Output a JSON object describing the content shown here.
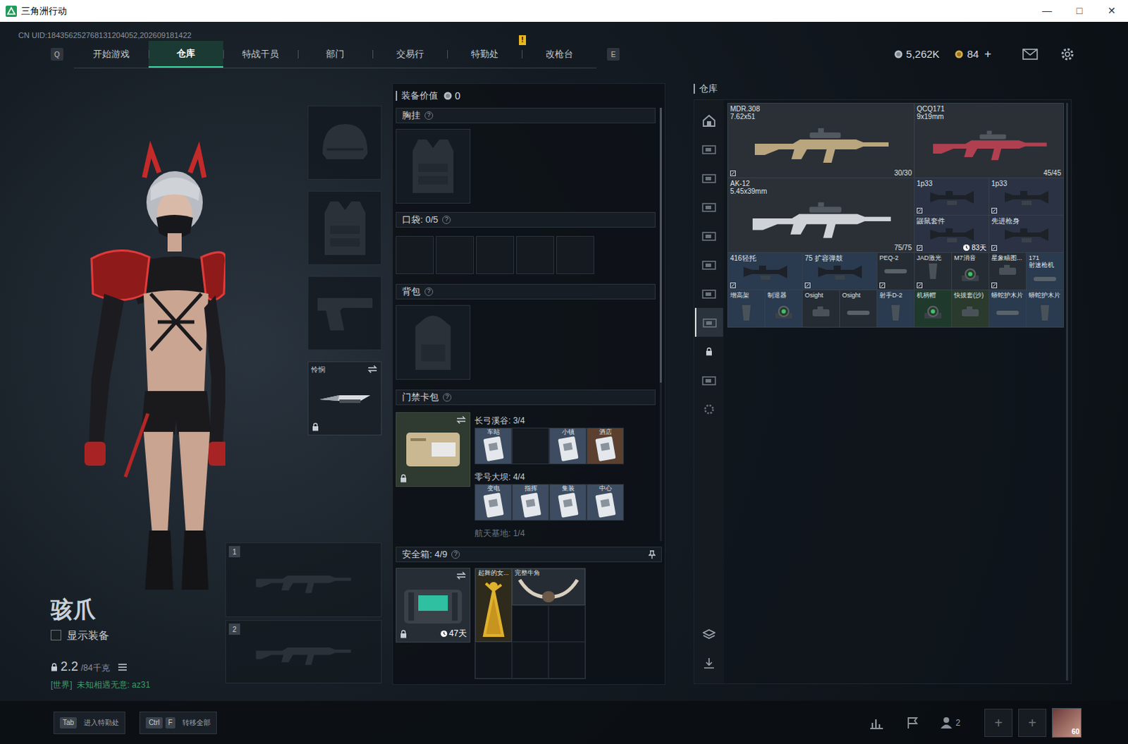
{
  "window": {
    "title": "三角洲行动",
    "controls": [
      "—",
      "□",
      "✕"
    ]
  },
  "uid": "CN UID:184356252768131204052,202609181422",
  "nav": {
    "left_key": "Q",
    "right_key": "E",
    "tabs": [
      {
        "label": "开始游戏",
        "selected": false,
        "badge": ""
      },
      {
        "label": "仓库",
        "selected": true,
        "badge": ""
      },
      {
        "label": "特战干员",
        "selected": false,
        "badge": ""
      },
      {
        "label": "部门",
        "selected": false,
        "badge": ""
      },
      {
        "label": "交易行",
        "selected": false,
        "badge": ""
      },
      {
        "label": "特勤处",
        "selected": false,
        "badge": "!"
      },
      {
        "label": "改枪台",
        "selected": false,
        "badge": ""
      }
    ]
  },
  "currency": {
    "silver": "5,262K",
    "gold": "84",
    "add": "+"
  },
  "operator": {
    "name": "骇爪",
    "show_equipment": {
      "label": "显示装备",
      "checked": false
    },
    "weight": "2.2",
    "weight_max": "/84千克",
    "chat": {
      "channel": "[世界]",
      "text": "未知相遇无意: az31"
    }
  },
  "equipment": {
    "slots": [
      {
        "kind": "helmet",
        "filled": false,
        "label": "",
        "locked": false
      },
      {
        "kind": "armor",
        "filled": false,
        "label": "",
        "locked": false
      },
      {
        "kind": "pistol",
        "filled": false,
        "label": "",
        "locked": false
      },
      {
        "kind": "melee",
        "filled": true,
        "label": "怜悯",
        "locked": true
      }
    ],
    "weapon_slots": [
      "1",
      "2"
    ]
  },
  "loadout": {
    "value_label": "装备价值",
    "value": "0",
    "chest": {
      "title": "胸挂",
      "help": "?",
      "filled": false
    },
    "pocket": {
      "title": "口袋: 0/5",
      "help": "?",
      "slots": [
        {
          "filled": false
        },
        {
          "filled": false
        },
        {
          "filled": false
        },
        {
          "filled": false
        },
        {
          "filled": false
        }
      ]
    },
    "backpack": {
      "title": "背包",
      "help": "?",
      "filled": false
    },
    "card_pack": {
      "title": "门禁卡包",
      "help": "?",
      "locked": true,
      "groups": [
        {
          "name": "长弓溪谷: 3/4",
          "dim": false,
          "cards": [
            {
              "label": "车站",
              "filled": true,
              "color": "#3d4c60"
            },
            {
              "label": "",
              "filled": false,
              "color": "#141a20"
            },
            {
              "label": "小镇",
              "filled": true,
              "color": "#3d4c60"
            },
            {
              "label": "酒店",
              "filled": true,
              "color": "#5b4030"
            }
          ]
        },
        {
          "name": "零号大坝: 4/4",
          "dim": false,
          "cards": [
            {
              "label": "变电",
              "filled": true,
              "color": "#3d4c60"
            },
            {
              "label": "指挥",
              "filled": true,
              "color": "#3d4c60"
            },
            {
              "label": "集装",
              "filled": true,
              "color": "#3d4c60"
            },
            {
              "label": "中心",
              "filled": true,
              "color": "#3d4c60"
            }
          ]
        },
        {
          "name": "航天基地: 1/4",
          "dim": true,
          "cards": []
        }
      ]
    },
    "safe_box": {
      "title": "安全箱: 4/9",
      "help": "?",
      "days": "47天",
      "locked": true,
      "items": [
        {
          "label": "起舞的女...",
          "kind": "tall",
          "color": "#2e2a1c"
        },
        {
          "label": "完整牛角",
          "kind": "wide",
          "color": "#262c33"
        }
      ]
    }
  },
  "warehouse": {
    "title": "仓库",
    "sidebar": [
      {
        "kind": "home",
        "selected": false
      },
      {
        "kind": "tab",
        "selected": false
      },
      {
        "kind": "tab",
        "selected": false
      },
      {
        "kind": "tab",
        "selected": false
      },
      {
        "kind": "tab",
        "selected": false
      },
      {
        "kind": "tab",
        "selected": false
      },
      {
        "kind": "tab",
        "selected": false
      },
      {
        "kind": "tab",
        "selected": true
      },
      {
        "kind": "lock",
        "selected": false
      },
      {
        "kind": "tab",
        "selected": false
      },
      {
        "kind": "gear",
        "selected": false
      }
    ],
    "sidebar_bottom": [
      {
        "kind": "stack"
      },
      {
        "kind": "transfer"
      }
    ],
    "items": [
      {
        "name": "MDR.308",
        "sub": "7.62x51",
        "count": "30/30",
        "timer": "",
        "bound": true,
        "color": "#2b3036",
        "kind": "rifle"
      },
      {
        "name": "QCQ171",
        "sub": "9x19mm",
        "count": "45/45",
        "timer": "",
        "bound": false,
        "color": "#2b3036",
        "kind": "smg"
      },
      {
        "name": "AK-12",
        "sub": "5.45x39mm",
        "count": "75/75",
        "timer": "",
        "bound": false,
        "color": "#2b3036",
        "kind": "rifle"
      },
      {
        "name": "1p33",
        "sub": "",
        "count": "",
        "timer": "",
        "bound": true,
        "color": "#2b3244",
        "kind": "wide"
      },
      {
        "name": "1p33",
        "sub": "",
        "count": "",
        "timer": "",
        "bound": true,
        "color": "#2b3244",
        "kind": "wide"
      },
      {
        "name": "鼹鼠套件",
        "sub": "",
        "count": "",
        "timer": "83天",
        "bound": true,
        "color": "#2b3244",
        "kind": "wide"
      },
      {
        "name": "先进枪身",
        "sub": "",
        "count": "",
        "timer": "",
        "bound": true,
        "color": "#2b3244",
        "kind": "wide"
      },
      {
        "name": "416轻托",
        "sub": "",
        "count": "",
        "timer": "",
        "bound": true,
        "color": "#2a3a4f",
        "kind": "wide"
      },
      {
        "name": "75 扩容弹鼓",
        "sub": "",
        "count": "",
        "timer": "",
        "bound": true,
        "color": "#2a3a4f",
        "kind": "wide"
      },
      {
        "name": "PEQ-2",
        "sub": "",
        "count": "",
        "timer": "",
        "bound": true,
        "color": "#262c34",
        "kind": "small"
      },
      {
        "name": "JAD激光",
        "sub": "",
        "count": "",
        "timer": "",
        "bound": true,
        "color": "#262c34",
        "kind": "small"
      },
      {
        "name": "M7消音",
        "sub": "",
        "count": "",
        "timer": "",
        "bound": false,
        "color": "#262c34",
        "kind": "small"
      },
      {
        "name": "星象瞄图...",
        "sub": "",
        "count": "",
        "timer": "",
        "bound": true,
        "color": "#262c34",
        "kind": "small"
      },
      {
        "name": "171",
        "sub": "射速枪机",
        "count": "",
        "timer": "",
        "bound": false,
        "color": "#2a3a4f",
        "kind": "small"
      },
      {
        "name": "增高架",
        "sub": "",
        "count": "",
        "timer": "",
        "bound": false,
        "color": "#2a3a4f",
        "kind": "small"
      },
      {
        "name": "制退器",
        "sub": "",
        "count": "",
        "timer": "",
        "bound": false,
        "color": "#2a3a4f",
        "kind": "small"
      },
      {
        "name": "Osight",
        "sub": "",
        "count": "",
        "timer": "",
        "bound": false,
        "color": "#262c34",
        "kind": "small"
      },
      {
        "name": "Osight",
        "sub": "",
        "count": "",
        "timer": "",
        "bound": false,
        "color": "#262c34",
        "kind": "small"
      },
      {
        "name": "射手D-2",
        "sub": "",
        "count": "",
        "timer": "",
        "bound": false,
        "color": "#2a3a4f",
        "kind": "small"
      },
      {
        "name": "机柄帽",
        "sub": "",
        "count": "",
        "timer": "",
        "bound": false,
        "color": "#1f3a2c",
        "kind": "small"
      },
      {
        "name": "快拔套(沙)",
        "sub": "",
        "count": "",
        "timer": "",
        "bound": false,
        "color": "#2a3a2c",
        "kind": "small"
      },
      {
        "name": "蟒蛇护木片",
        "sub": "",
        "count": "",
        "timer": "",
        "bound": false,
        "color": "#2a3a4f",
        "kind": "small"
      },
      {
        "name": "蟒蛇护木片",
        "sub": "",
        "count": "",
        "timer": "",
        "bound": false,
        "color": "#2a3a4f",
        "kind": "small"
      }
    ]
  },
  "bottom": {
    "hints": [
      {
        "keys": [
          "Tab"
        ],
        "label": "进入特勤处"
      },
      {
        "keys": [
          "Ctrl",
          "F"
        ],
        "label": "转移全部"
      }
    ],
    "friends": "2",
    "party_slots": [
      "+",
      "+"
    ],
    "avatar_level": "60"
  }
}
